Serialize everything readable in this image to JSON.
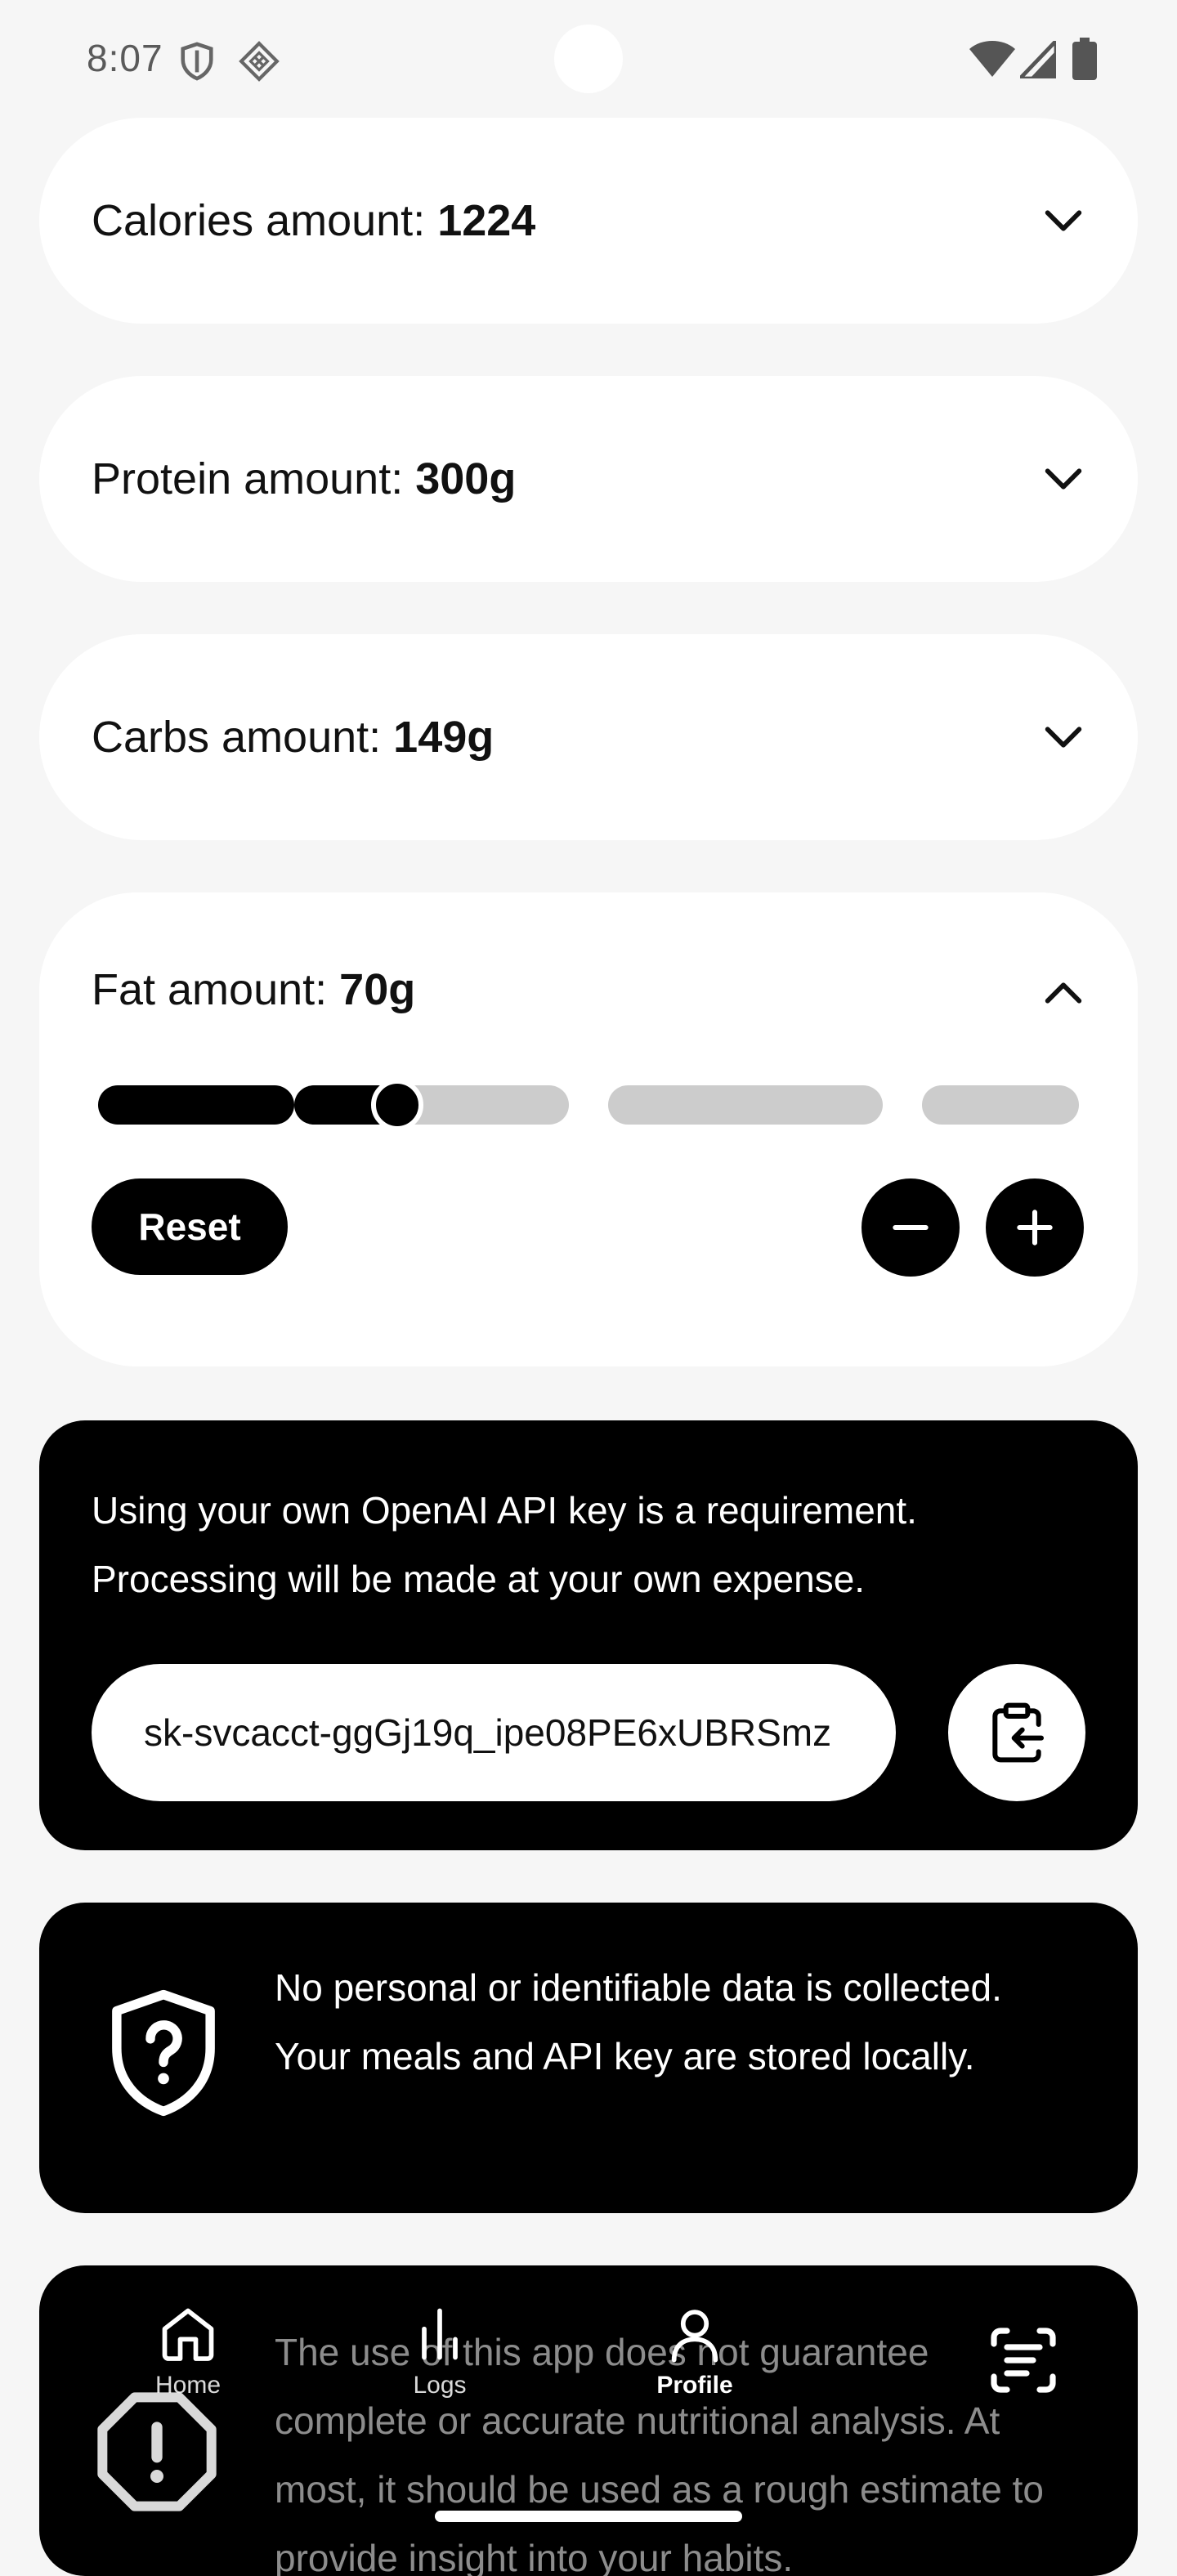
{
  "status_bar": {
    "time": "8:07",
    "icons": [
      "shield-outline-icon",
      "diamond-grid-icon",
      "wifi-icon",
      "signal-icon",
      "battery-icon"
    ]
  },
  "macros": {
    "calories": {
      "label": "Calories amount: ",
      "value": "1224",
      "expanded": false
    },
    "protein": {
      "label": "Protein amount: ",
      "value": "300g",
      "expanded": false
    },
    "carbs": {
      "label": "Carbs amount: ",
      "value": "149g",
      "expanded": false
    },
    "fat": {
      "label": "Fat amount: ",
      "value": "70g",
      "expanded": true,
      "slider_segments": 4,
      "slider_level_fraction": 0.305,
      "reset_label": "Reset",
      "decrement_icon": "minus-icon",
      "increment_icon": "plus-icon"
    }
  },
  "api_key": {
    "description": "Using your own OpenAI API key is a requirement. Processing will be made at your own expense.",
    "value": "sk-svcacct-ggGj19q_ipe08PE6xUBRSmz",
    "paste_icon": "clipboard-paste-icon"
  },
  "privacy": {
    "icon": "shield-question-icon",
    "text": "No personal or identifiable data is collected. Your meals and API key are stored locally."
  },
  "disclaimer": {
    "icon": "octagon-alert-icon",
    "text": "The use of this app does not guarantee complete or accurate nutritional analysis. At most, it should be used as a rough estimate to provide insight into your habits."
  },
  "bottom_nav": {
    "items": [
      {
        "label": "Home",
        "icon": "home-icon",
        "active": false
      },
      {
        "label": "Logs",
        "icon": "bar-chart-icon",
        "active": false
      },
      {
        "label": "Profile",
        "icon": "user-icon",
        "active": true
      }
    ],
    "scan_icon": "scan-text-icon"
  },
  "colors": {
    "background": "#f6f6f6",
    "card_light": "#ffffff",
    "card_dark": "#000000",
    "track": "#cccccc"
  }
}
